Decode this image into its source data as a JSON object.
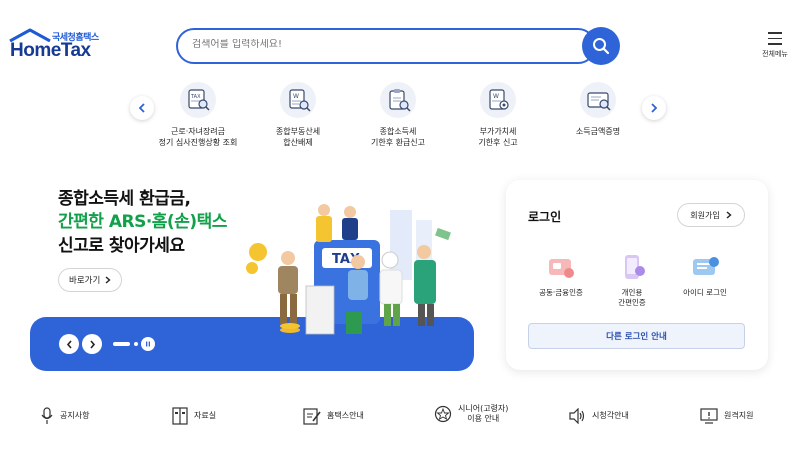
{
  "header": {
    "logo_sub": "국세청홈택스",
    "logo_main": "HomeTax",
    "search_placeholder": "검색어를 입력하세요!",
    "menu_label": "전체메뉴"
  },
  "quick_menu": [
    {
      "label": "근로·자녀장려금\n정기 심사진행상황 조회",
      "icon": "tax-document-search-icon"
    },
    {
      "label": "종합부동산세\n합산배제",
      "icon": "property-tax-document-icon"
    },
    {
      "label": "종합소득세\n기한후 환급신고",
      "icon": "income-tax-clipboard-icon"
    },
    {
      "label": "부가가치세\n기한후 신고",
      "icon": "vat-document-icon"
    },
    {
      "label": "소득금액증명",
      "icon": "income-certificate-icon"
    }
  ],
  "banner": {
    "line1": "종합소득세 환급금,",
    "line2": "간편한 ARS·홈(손)택스",
    "line3": "신고로 찾아가세요",
    "more_label": "바로가기",
    "illustration_sign": "TAX",
    "accent_color": "#2f64d8",
    "highlight_color": "#12a04a"
  },
  "login": {
    "title": "로그인",
    "join_label": "회원가입",
    "options": [
      {
        "label": "공동·금융인증",
        "icon": "certificate-card-icon"
      },
      {
        "label": "개인용\n간편인증",
        "icon": "mobile-auth-icon"
      },
      {
        "label": "아이디 로그인",
        "icon": "id-login-icon"
      }
    ],
    "other_label": "다른 로그인 안내"
  },
  "bottom_links": [
    {
      "label": "공지사항",
      "icon": "microphone-icon"
    },
    {
      "label": "자료실",
      "icon": "archive-icon"
    },
    {
      "label": "홈택스안내",
      "icon": "guide-edit-icon"
    },
    {
      "label": "시니어(고령자)\n이용 안내",
      "icon": "senior-badge-icon"
    },
    {
      "label": "시청각안내",
      "icon": "speaker-icon"
    },
    {
      "label": "원격지원",
      "icon": "remote-support-icon"
    }
  ]
}
